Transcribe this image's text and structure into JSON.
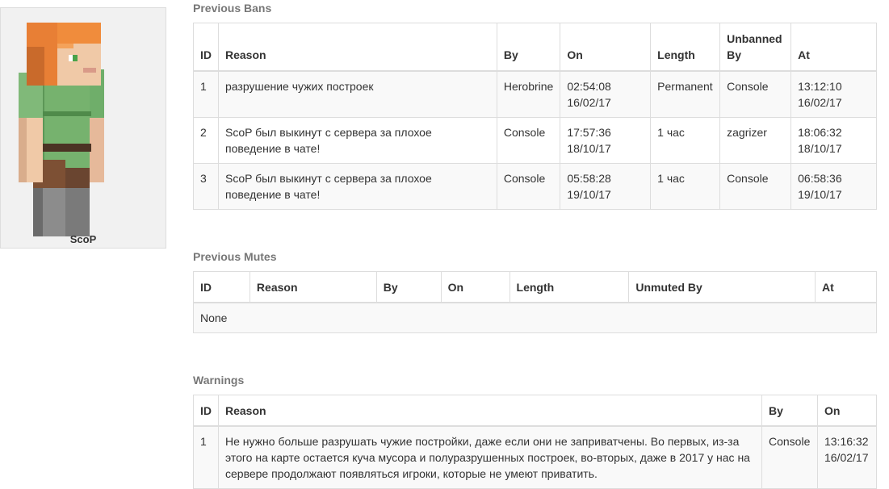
{
  "player": {
    "name": "ScoP",
    "avatar": "player-skin"
  },
  "bans": {
    "title": "Previous Bans",
    "headers": {
      "id": "ID",
      "reason": "Reason",
      "by": "By",
      "on": "On",
      "length": "Length",
      "unbanned_by_1": "Unbanned",
      "unbanned_by_2": "By",
      "at": "At"
    },
    "rows": [
      {
        "id": "1",
        "reason": "разрушение чужих построек",
        "by": "Herobrine",
        "on_time": "02:54:08",
        "on_date": "16/02/17",
        "length": "Permanent",
        "unbanned_by": "Console",
        "at_time": "13:12:10",
        "at_date": "16/02/17"
      },
      {
        "id": "2",
        "reason": "ScoP был выкинут с сервера за плохое поведение в чате!",
        "by": "Console",
        "on_time": "17:57:36",
        "on_date": "18/10/17",
        "length": "1 час",
        "unbanned_by": "zagrizer",
        "at_time": "18:06:32",
        "at_date": "18/10/17"
      },
      {
        "id": "3",
        "reason": "ScoP был выкинут с сервера за плохое поведение в чате!",
        "by": "Console",
        "on_time": "05:58:28",
        "on_date": "19/10/17",
        "length": "1 час",
        "unbanned_by": "Console",
        "at_time": "06:58:36",
        "at_date": "19/10/17"
      }
    ]
  },
  "mutes": {
    "title": "Previous Mutes",
    "headers": {
      "id": "ID",
      "reason": "Reason",
      "by": "By",
      "on": "On",
      "length": "Length",
      "unmuted_by": "Unmuted By",
      "at": "At"
    },
    "empty_text": "None"
  },
  "warnings": {
    "title": "Warnings",
    "headers": {
      "id": "ID",
      "reason": "Reason",
      "by": "By",
      "on": "On"
    },
    "rows": [
      {
        "id": "1",
        "reason": "Не нужно больше разрушать чужие постройки, даже если они не заприватчены. Во первых, из-за этого на карте остается куча мусора и полуразрушенных построек, во-вторых, даже в 2017 у нас на сервере продолжают появляться игроки, которые не умеют приватить.",
        "by": "Console",
        "on_time": "13:16:32",
        "on_date": "16/02/17"
      }
    ]
  }
}
